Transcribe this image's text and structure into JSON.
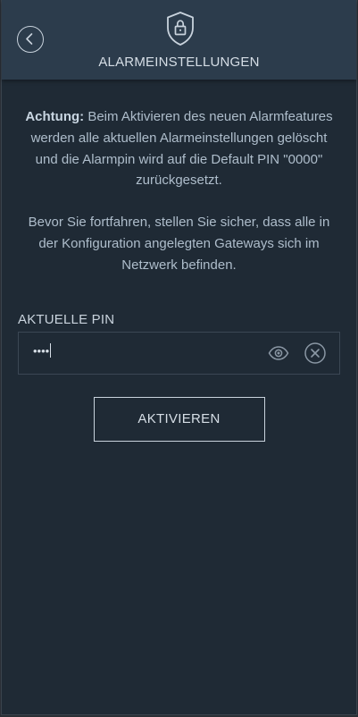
{
  "header": {
    "title": "ALARMEINSTELLUNGEN"
  },
  "notice": {
    "bold_prefix": "Achtung:",
    "paragraph1": " Beim Aktivieren des neuen Alarmfeatures werden alle aktuellen Alarmeinstellungen gelöscht und die Alarmpin wird auf die Default PIN \"0000\" zurückgesetzt.",
    "paragraph2": "Bevor Sie fortfahren, stellen Sie sicher, dass alle in der Konfiguration angelegten Gateways sich im Netzwerk befinden."
  },
  "pin": {
    "label": "AKTUELLE PIN",
    "masked_value": "••••"
  },
  "actions": {
    "activate_label": "AKTIVIEREN"
  },
  "icons": {
    "back": "chevron-left-icon",
    "header": "shield-lock-icon",
    "show_password": "eye-icon",
    "clear": "clear-icon"
  }
}
